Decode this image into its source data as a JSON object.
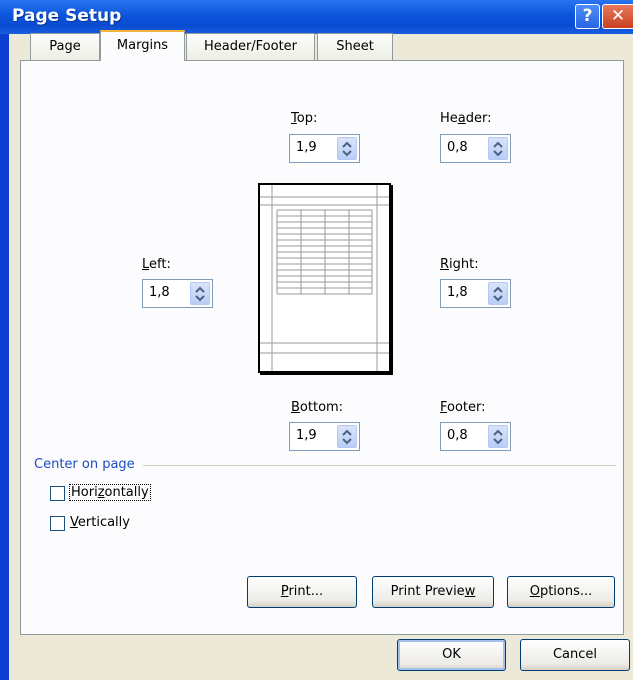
{
  "window": {
    "title": "Page Setup",
    "help_label": "?",
    "close_label": "✕"
  },
  "tabs": [
    {
      "label": "Page",
      "active": false
    },
    {
      "label": "Margins",
      "active": true
    },
    {
      "label": "Header/Footer",
      "active": false
    },
    {
      "label": "Sheet",
      "active": false
    }
  ],
  "margins": {
    "top": {
      "label_pre": "",
      "label_key": "T",
      "label_post": "op:",
      "value": "1,9"
    },
    "header": {
      "label_pre": "He",
      "label_key": "a",
      "label_post": "der:",
      "value": "0,8"
    },
    "left": {
      "label_pre": "",
      "label_key": "L",
      "label_post": "eft:",
      "value": "1,8"
    },
    "right": {
      "label_pre": "",
      "label_key": "R",
      "label_post": "ight:",
      "value": "1,8"
    },
    "bottom": {
      "label_pre": "",
      "label_key": "B",
      "label_post": "ottom:",
      "value": "1,9"
    },
    "footer": {
      "label_pre": "",
      "label_key": "F",
      "label_post": "ooter:",
      "value": "0,8"
    }
  },
  "center_on_page": {
    "legend": "Center on page",
    "horizontally": {
      "label_pre": "Hori",
      "label_key": "z",
      "label_post": "ontally",
      "checked": false
    },
    "vertically": {
      "label_pre": "",
      "label_key": "V",
      "label_post": "ertically",
      "checked": false
    }
  },
  "buttons": {
    "print": {
      "pre": "",
      "key": "P",
      "post": "rint..."
    },
    "print_preview": {
      "pre": "Print Previe",
      "key": "w",
      "post": ""
    },
    "options": {
      "pre": "",
      "key": "O",
      "post": "ptions..."
    },
    "ok": "OK",
    "cancel": "Cancel"
  },
  "colors": {
    "titlebar": "#0b55dd",
    "dialog_bg": "#ece9d8",
    "tab_accent": "#f5b33b",
    "legend_text": "#1a4dbd"
  }
}
